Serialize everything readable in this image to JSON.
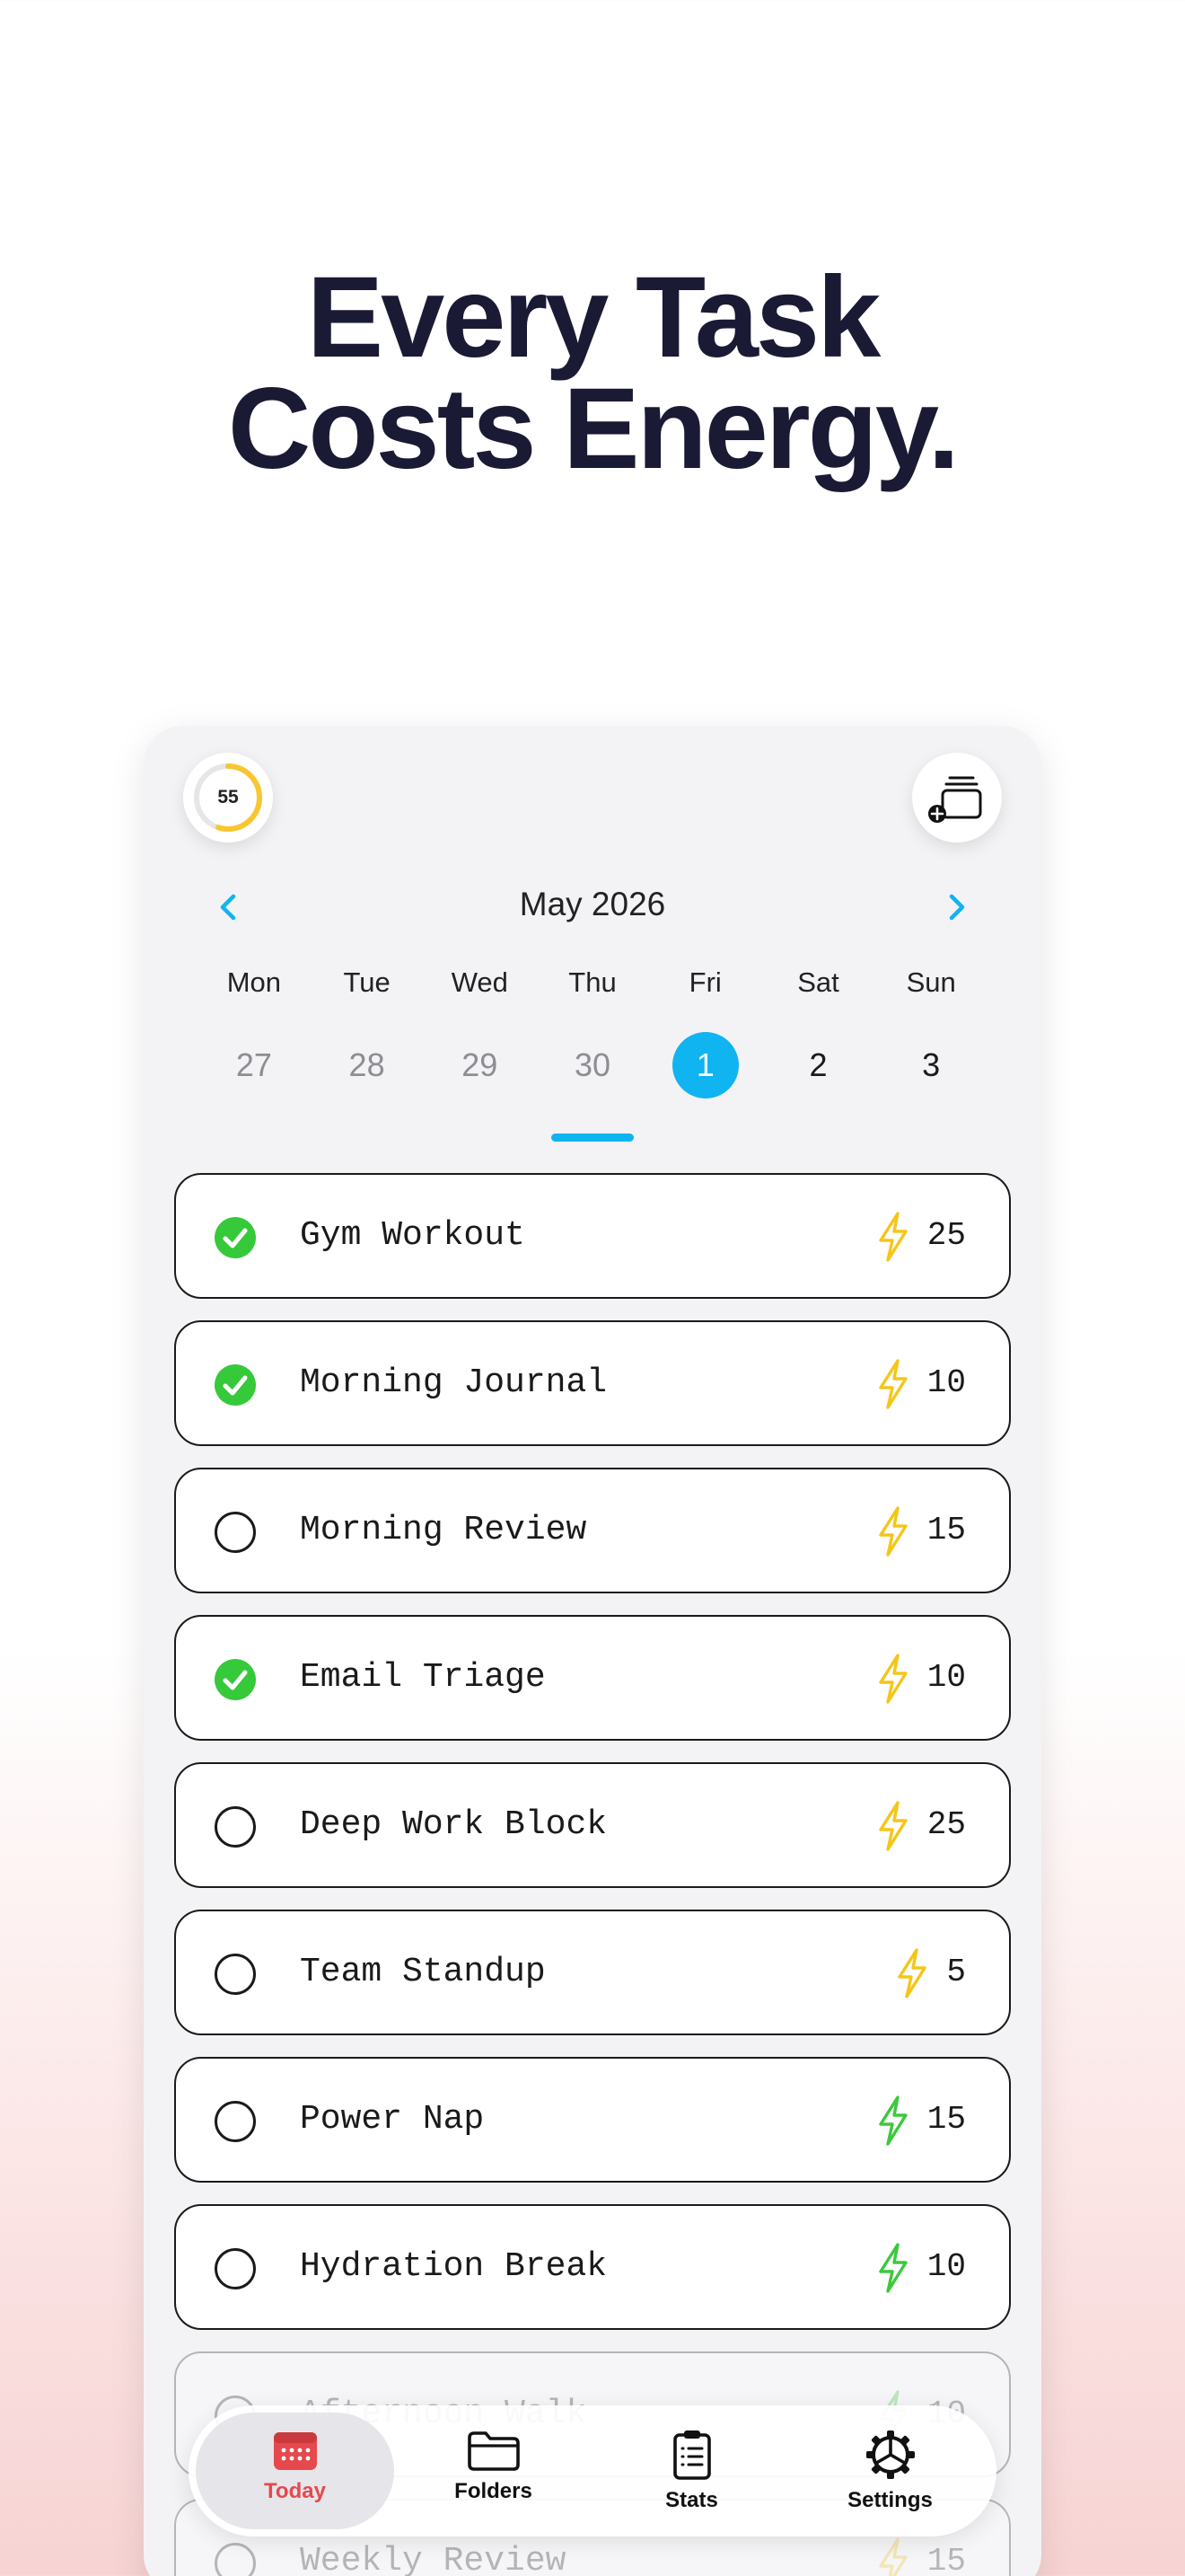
{
  "headline": {
    "line1": "Every Task",
    "line2": "Costs Energy."
  },
  "header": {
    "energy_value": "55",
    "energy_fraction": 0.55
  },
  "calendar": {
    "month": "May 2026",
    "weekdays": [
      "Mon",
      "Tue",
      "Wed",
      "Thu",
      "Fri",
      "Sat",
      "Sun"
    ],
    "dates": [
      "27",
      "28",
      "29",
      "30",
      "1",
      "2",
      "3"
    ],
    "selected_index": 4
  },
  "tasks": [
    {
      "name": "Gym Workout",
      "cost": "25",
      "done": true,
      "bolt": "yellow"
    },
    {
      "name": "Morning Journal",
      "cost": "10",
      "done": true,
      "bolt": "yellow"
    },
    {
      "name": "Morning Review",
      "cost": "15",
      "done": false,
      "bolt": "yellow"
    },
    {
      "name": "Email Triage",
      "cost": "10",
      "done": true,
      "bolt": "yellow"
    },
    {
      "name": "Deep Work Block",
      "cost": "25",
      "done": false,
      "bolt": "yellow"
    },
    {
      "name": "Team Standup",
      "cost": "5",
      "done": false,
      "bolt": "yellow"
    },
    {
      "name": "Power Nap",
      "cost": "15",
      "done": false,
      "bolt": "green"
    },
    {
      "name": "Hydration Break",
      "cost": "10",
      "done": false,
      "bolt": "green"
    },
    {
      "name": "Afternoon Walk",
      "cost": "10",
      "done": false,
      "bolt": "green"
    },
    {
      "name": "Weekly Review",
      "cost": "15",
      "done": false,
      "bolt": "yellow"
    }
  ],
  "tabs": [
    {
      "label": "Today",
      "icon": "calendar-icon"
    },
    {
      "label": "Folders",
      "icon": "folder-icon"
    },
    {
      "label": "Stats",
      "icon": "clipboard-icon"
    },
    {
      "label": "Settings",
      "icon": "gear-icon"
    }
  ],
  "colors": {
    "accent": "#10b4f0",
    "ring": "#f8c630",
    "check_done": "#36c93a",
    "bolt_yellow": "#f5c518",
    "bolt_green": "#3cc83c",
    "tab_active": "#e5484d"
  }
}
